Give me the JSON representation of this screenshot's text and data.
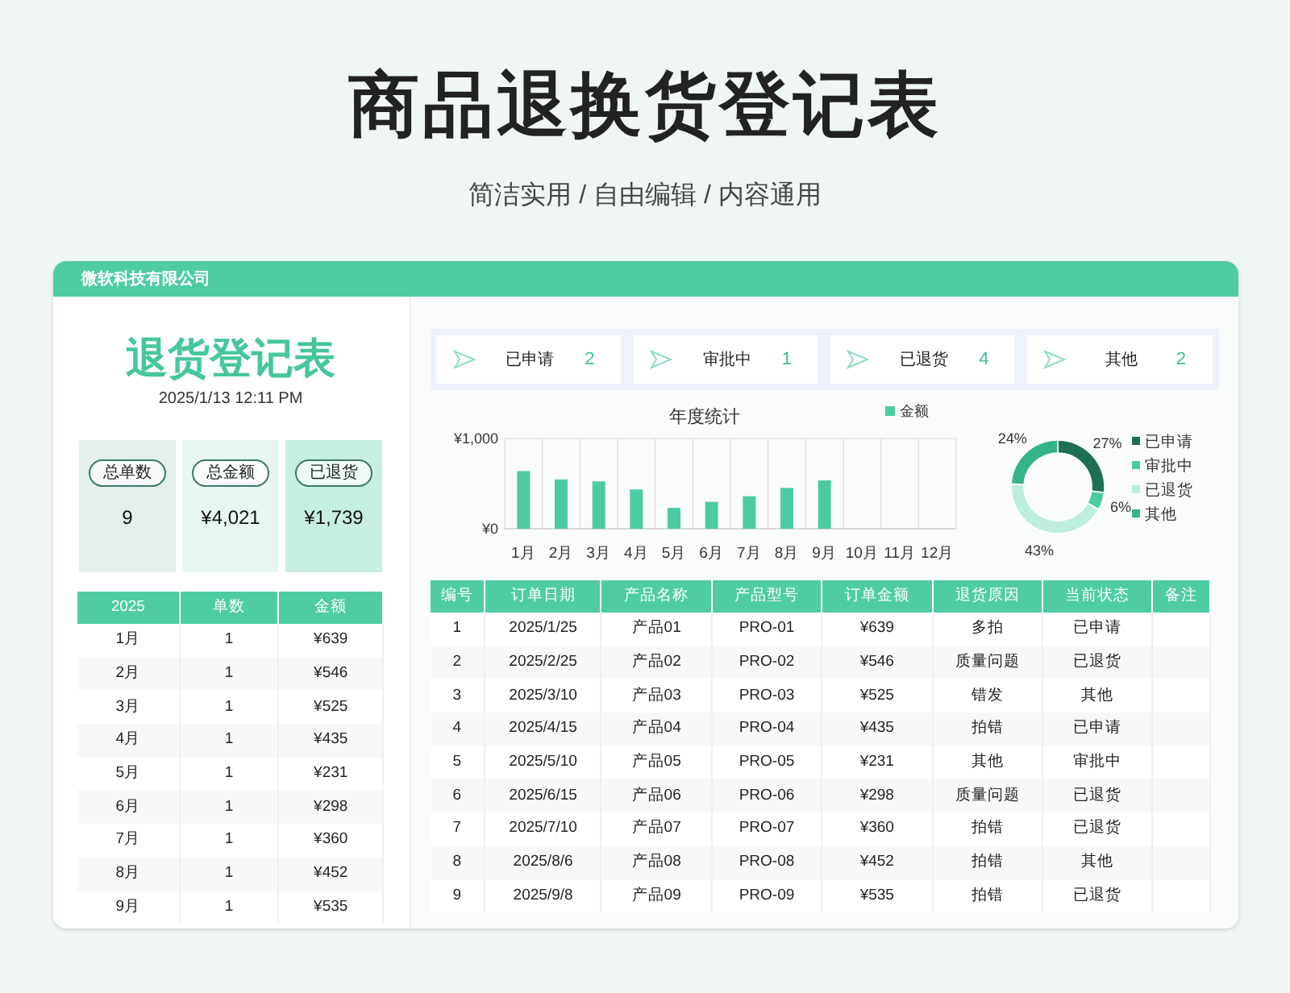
{
  "page": {
    "title": "商品退换货登记表",
    "subtitle": "简洁实用 / 自由编辑 / 内容通用"
  },
  "card": {
    "company": "微软科技有限公司"
  },
  "summary": {
    "title": "退货登记表",
    "datetime": "2025/1/13 12:11 PM",
    "stats": [
      {
        "label": "总单数",
        "value": "9",
        "color": "#e4eeea"
      },
      {
        "label": "总金额",
        "value": "¥4,021",
        "color": "#e8f6f1"
      },
      {
        "label": "已退货",
        "value": "¥1,739",
        "color": "#c6efe0"
      }
    ]
  },
  "status_counts": [
    {
      "label": "已申请",
      "count": "2"
    },
    {
      "label": "审批中",
      "count": "1"
    },
    {
      "label": "已退货",
      "count": "4"
    },
    {
      "label": "其他",
      "count": "2"
    }
  ],
  "bar_chart": {
    "chart_data": {
      "type": "bar",
      "title": "年度统计",
      "categories": [
        "1月",
        "2月",
        "3月",
        "4月",
        "5月",
        "6月",
        "7月",
        "8月",
        "9月",
        "10月",
        "11月",
        "12月"
      ],
      "series": [
        {
          "name": "金额",
          "color": "#4ccba2",
          "values": [
            639,
            546,
            525,
            435,
            231,
            298,
            360,
            452,
            535,
            null,
            null,
            null
          ]
        }
      ],
      "ylim": [
        0,
        1000
      ],
      "yticks": [
        {
          "value": 0,
          "label": "¥0"
        },
        {
          "value": 1000,
          "label": "¥1,000"
        }
      ]
    }
  },
  "donut_chart": {
    "chart_data": {
      "type": "donut",
      "categories": [
        "已申请",
        "审批中",
        "已退货",
        "其他"
      ],
      "series": [
        {
          "values": [
            27,
            6,
            43,
            24
          ]
        }
      ],
      "legend": "right",
      "colors": [
        "#1f6f52",
        "#4ccba2",
        "#bdeedc",
        "#35b488"
      ],
      "value_labels": [
        "27%",
        "6%",
        "43%",
        "24%"
      ]
    }
  },
  "monthly_table": {
    "columns": [
      "2025",
      "单数",
      "金额"
    ],
    "rows": [
      [
        "1月",
        "1",
        "¥639"
      ],
      [
        "2月",
        "1",
        "¥546"
      ],
      [
        "3月",
        "1",
        "¥525"
      ],
      [
        "4月",
        "1",
        "¥435"
      ],
      [
        "5月",
        "1",
        "¥231"
      ],
      [
        "6月",
        "1",
        "¥298"
      ],
      [
        "7月",
        "1",
        "¥360"
      ],
      [
        "8月",
        "1",
        "¥452"
      ],
      [
        "9月",
        "1",
        "¥535"
      ]
    ]
  },
  "orders_table": {
    "columns": [
      "编号",
      "订单日期",
      "产品名称",
      "产品型号",
      "订单金额",
      "退货原因",
      "当前状态",
      "备注"
    ],
    "rows": [
      [
        "1",
        "2025/1/25",
        "产品01",
        "PRO-01",
        "¥639",
        "多拍",
        "已申请"
      ],
      [
        "2",
        "2025/2/25",
        "产品02",
        "PRO-02",
        "¥546",
        "质量问题",
        "已退货"
      ],
      [
        "3",
        "2025/3/10",
        "产品03",
        "PRO-03",
        "¥525",
        "错发",
        "其他"
      ],
      [
        "4",
        "2025/4/15",
        "产品04",
        "PRO-04",
        "¥435",
        "拍错",
        "已申请"
      ],
      [
        "5",
        "2025/5/10",
        "产品05",
        "PRO-05",
        "¥231",
        "其他",
        "审批中"
      ],
      [
        "6",
        "2025/6/15",
        "产品06",
        "PRO-06",
        "¥298",
        "质量问题",
        "已退货"
      ],
      [
        "7",
        "2025/7/10",
        "产品07",
        "PRO-07",
        "¥360",
        "拍错",
        "已退货"
      ],
      [
        "8",
        "2025/8/6",
        "产品08",
        "PRO-08",
        "¥452",
        "拍错",
        "其他"
      ],
      [
        "9",
        "2025/9/8",
        "产品09",
        "PRO-09",
        "¥535",
        "拍错",
        "已退货"
      ]
    ]
  }
}
